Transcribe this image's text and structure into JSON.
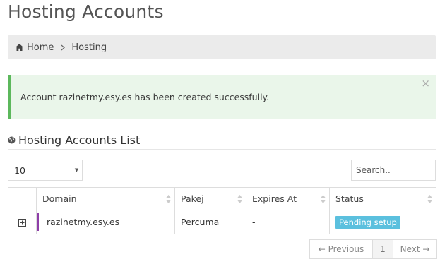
{
  "page": {
    "title": "Hosting Accounts"
  },
  "breadcrumb": {
    "items": [
      {
        "label": "Home",
        "icon": "home-icon"
      },
      {
        "label": "Hosting"
      }
    ]
  },
  "alert": {
    "message": "Account razinetmy.esy.es has been created successfully.",
    "close_symbol": "×",
    "accent": "#5cb85c",
    "background": "#eaf6ea"
  },
  "list": {
    "title": "Hosting Accounts List",
    "icon": "globe-icon",
    "page_length": "10",
    "search_placeholder": "Search..",
    "columns": [
      "Domain",
      "Pakej",
      "Expires At",
      "Status"
    ],
    "rows": [
      {
        "domain": "razinetmy.esy.es",
        "package": "Percuma",
        "expires": "-",
        "status": "Pending setup",
        "accent": "#8e3ea8"
      }
    ],
    "status_color": "#5bc0de"
  },
  "pagination": {
    "previous": "← Previous",
    "current": "1",
    "next": "Next →"
  }
}
